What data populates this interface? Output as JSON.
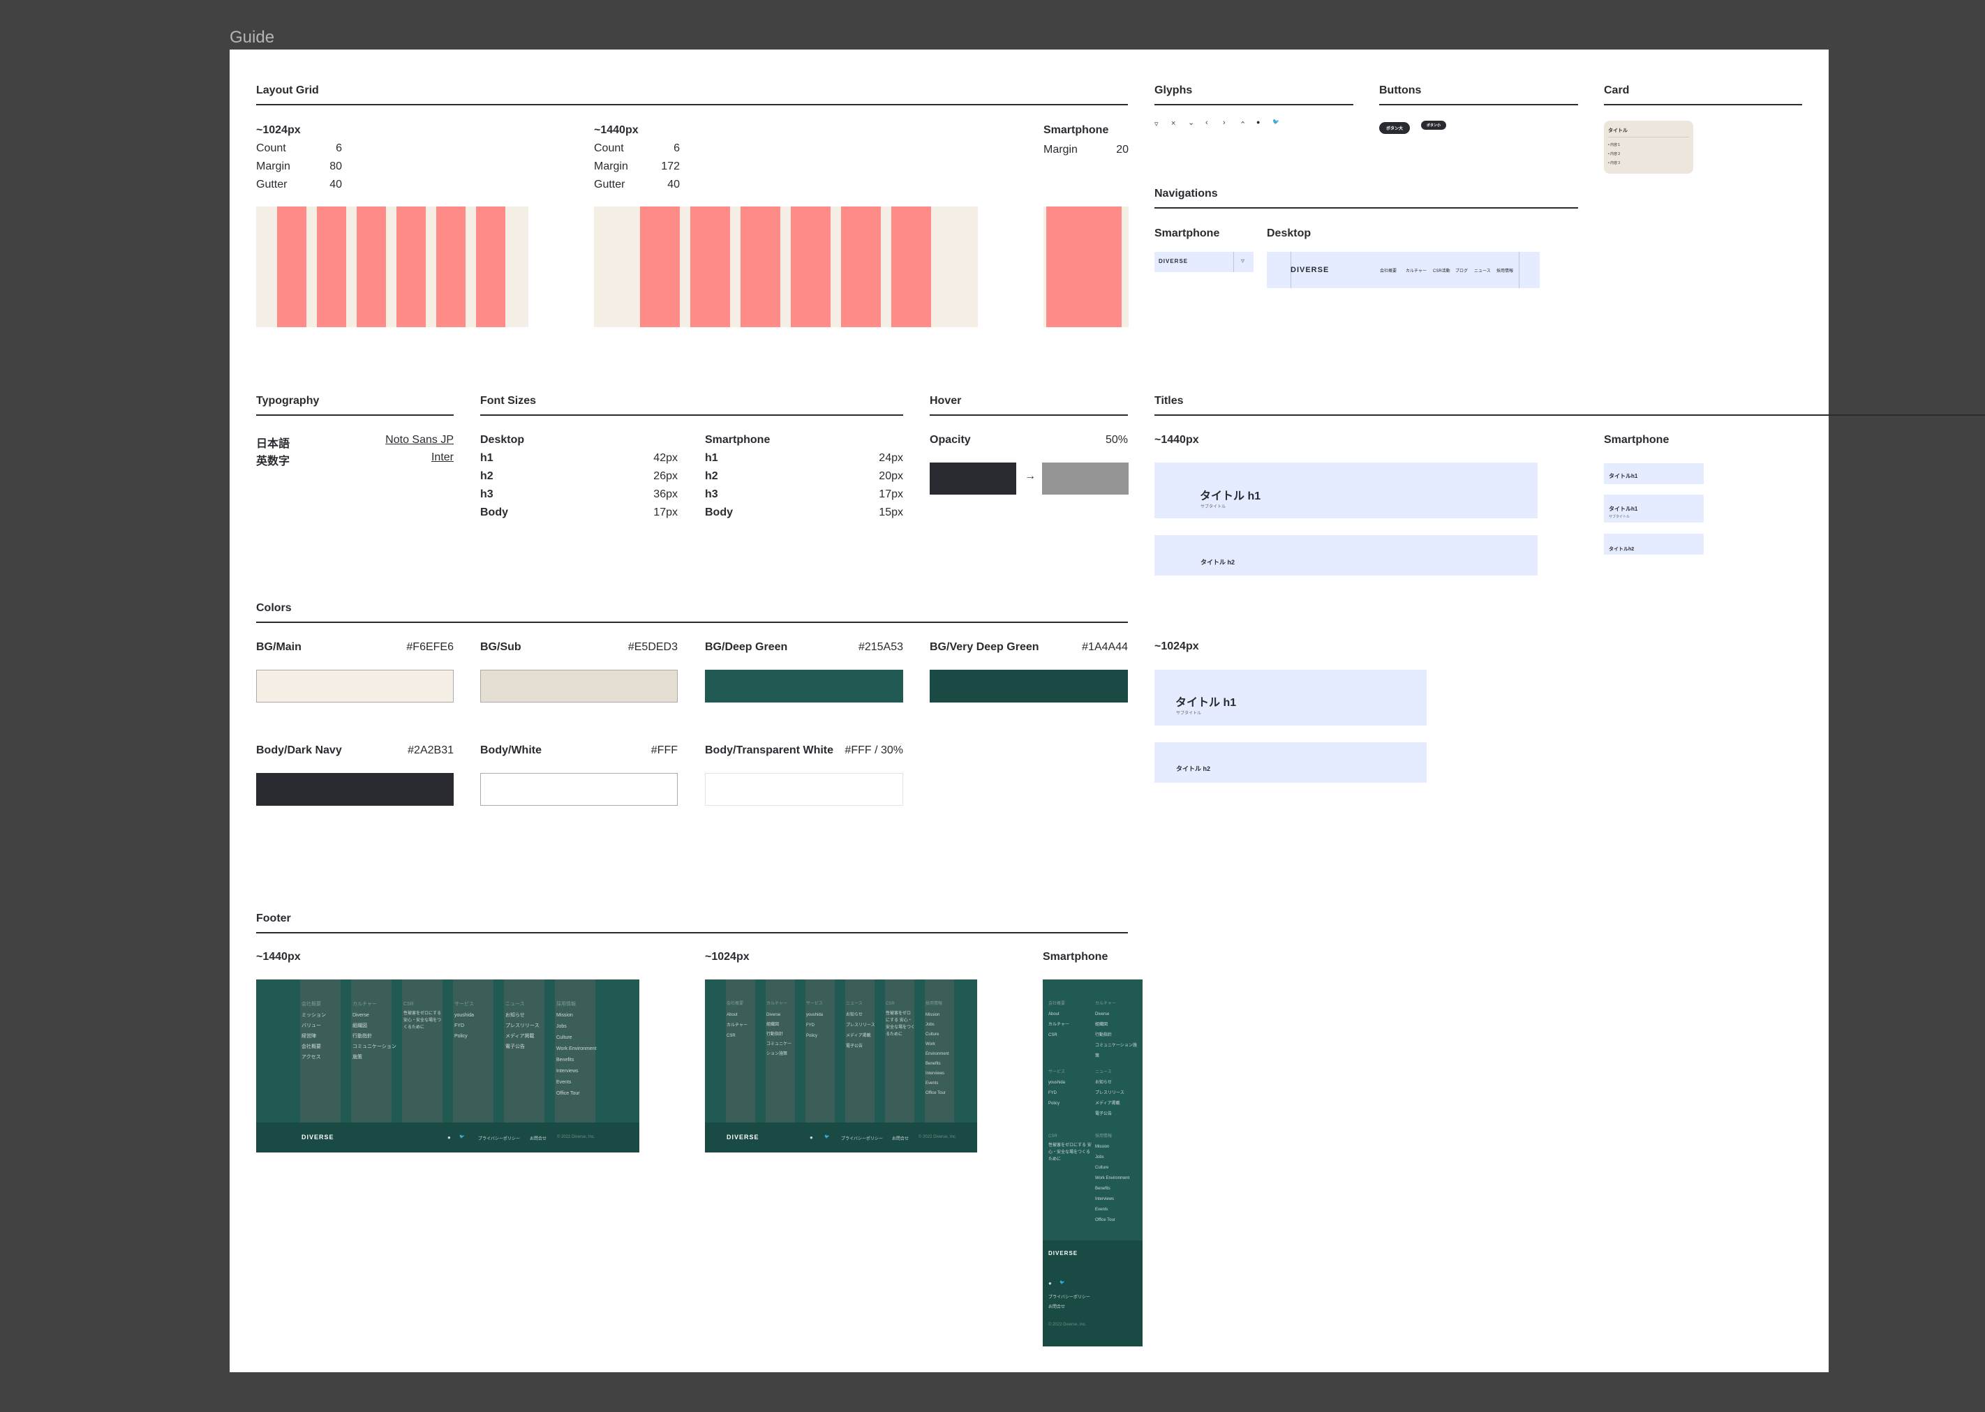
{
  "canvas": {
    "label": "Guide"
  },
  "sections": {
    "layout_grid": "Layout Grid",
    "glyphs": "Glyphs",
    "buttons": "Buttons",
    "card": "Card",
    "navigations": "Navigations",
    "typography": "Typography",
    "font_sizes": "Font Sizes",
    "hover": "Hover",
    "titles": "Titles",
    "colors": "Colors",
    "footer": "Footer"
  },
  "layout_grid": {
    "g1024": {
      "label": "~1024px",
      "count_label": "Count",
      "count": "6",
      "margin_label": "Margin",
      "margin": "80",
      "gutter_label": "Gutter",
      "gutter": "40"
    },
    "g1440": {
      "label": "~1440px",
      "count_label": "Count",
      "count": "6",
      "margin_label": "Margin",
      "margin": "172",
      "gutter_label": "Gutter",
      "gutter": "40"
    },
    "sp": {
      "label": "Smartphone",
      "margin_label": "Margin",
      "margin": "20"
    }
  },
  "glyphs": [
    "▿",
    "×",
    "⌄",
    "‹",
    "›",
    "⌃",
    "●",
    "🐦"
  ],
  "buttons": {
    "b1": "ボタン大",
    "b2": "ボタン小"
  },
  "card": {
    "title": "タイトル",
    "items": [
      "• 内容１",
      "• 内容２",
      "• 内容３"
    ]
  },
  "navigations": {
    "sp_label": "Smartphone",
    "desktop_label": "Desktop",
    "logo": "DIVERSE",
    "menu_icon": "▿",
    "links": [
      "会社概要",
      "カルチャー",
      "CSR活動",
      "ブログ",
      "ニュース",
      "採用情報"
    ]
  },
  "typography": {
    "rows": [
      {
        "k": "日本語",
        "v": "Noto Sans JP"
      },
      {
        "k": "英数字",
        "v": "Inter"
      }
    ]
  },
  "font_sizes": {
    "desktop": {
      "label": "Desktop",
      "rows": [
        {
          "k": "h1",
          "v": "42px"
        },
        {
          "k": "h2",
          "v": "26px"
        },
        {
          "k": "h3",
          "v": "36px"
        },
        {
          "k": "Body",
          "v": "17px"
        }
      ]
    },
    "smartphone": {
      "label": "Smartphone",
      "rows": [
        {
          "k": "h1",
          "v": "24px"
        },
        {
          "k": "h2",
          "v": "20px"
        },
        {
          "k": "h3",
          "v": "17px"
        },
        {
          "k": "Body",
          "v": "15px"
        }
      ]
    }
  },
  "hover": {
    "label": "Opacity",
    "value": "50%",
    "arrow": "→",
    "from_color": "#2A2B31",
    "to_color": "#959595"
  },
  "titles": {
    "w1440": "~1440px",
    "w1024": "~1024px",
    "sp": "Smartphone",
    "h1": "タイトル h1",
    "sub": "サブタイトル",
    "h2": "タイトル h2",
    "sp_h1": "タイトルh1",
    "sp_h2": "タイトルh2"
  },
  "colors": [
    {
      "name": "BG/Main",
      "hex": "#F6EFE6",
      "color": "#F6EFE6"
    },
    {
      "name": "BG/Sub",
      "hex": "#E5DED3",
      "color": "#E5DED3"
    },
    {
      "name": "BG/Deep Green",
      "hex": "#215A53",
      "color": "#215A53"
    },
    {
      "name": "BG/Very Deep Green",
      "hex": "#1A4A44",
      "color": "#1A4A44"
    },
    {
      "name": "Body/Dark Navy",
      "hex": "#2A2B31",
      "color": "#2A2B31"
    },
    {
      "name": "Body/White",
      "hex": "#FFF",
      "color": "#FFFFFF"
    },
    {
      "name": "Body/Transparent White",
      "hex": "#FFF / 30%",
      "color": "#FFFFFF"
    }
  ],
  "footer": {
    "w1440": "~1440px",
    "w1024": "~1024px",
    "sp": "Smartphone",
    "logo": "DIVERSE",
    "privacy": "プライバシーポリシー",
    "contact": "お問合せ",
    "copyright": "© 2022 Diverse, Inc.",
    "cols": [
      {
        "head": "会社概要",
        "items": "ミッション\nバリュー\n経営陣\n会社概要\nアクセス"
      },
      {
        "head": "カルチャー",
        "items": "Diverse\n組織図\n行動指針\nコミュニケーション\n施策"
      },
      {
        "head": "CSR",
        "items": "性被害をゼロにする\n安心・安全な場をつくるために"
      },
      {
        "head": "サービス",
        "items": "youshida\nFYD\nPolicy"
      },
      {
        "head": "ニュース",
        "items": "お知らせ\nプレスリリース\nメディア掲載\n電子公告"
      },
      {
        "head": "採用情報",
        "items": "Mission\nJobs\nCulture\nWork Environment\nBenefits\nInterviews\nEvents\nOffice Tour"
      }
    ],
    "sp_cols": [
      {
        "head": "会社概要",
        "items": "About\nカルチャー\nCSR"
      },
      {
        "head": "カルチャー",
        "items": "Diverse\n組織図\n行動指針\nコミュニケーション施策"
      },
      {
        "head": "サービス",
        "items": "youshida\nFYD\nPolicy"
      },
      {
        "head": "ニュース",
        "items": "お知らせ\nプレスリリース\nメディア掲載\n電子公告"
      },
      {
        "head": "CSR",
        "items": "性被害をゼロにする\n安心・安全な場をつくるために"
      },
      {
        "head": "採用情報",
        "items": "Mission\nJobs\nCulture\nWork Environment\nBenefits\nInterviews\nEvents\nOffice Tour"
      }
    ],
    "m1024_cols": [
      {
        "head": "会社概要",
        "items": "About\nカルチャー\nCSR"
      },
      {
        "head": "カルチャー",
        "items": "Diverse\n組織図\n行動指針\nコミュニケー\nション施策"
      },
      {
        "head": "サービス",
        "items": "youshida\nFYD\nPolicy"
      },
      {
        "head": "ニュース",
        "items": "お知らせ\nプレスリリース\nメディア掲載\n電子公告"
      },
      {
        "head": "CSR",
        "items": "性被害をゼロにする\n安心・安全な場をつくるために"
      },
      {
        "head": "採用情報",
        "items": "Mission\nJobs\nCulture\nWork\nEnvironment\nBenefits\nInterviews\nEvents\nOffice Tour"
      }
    ]
  }
}
